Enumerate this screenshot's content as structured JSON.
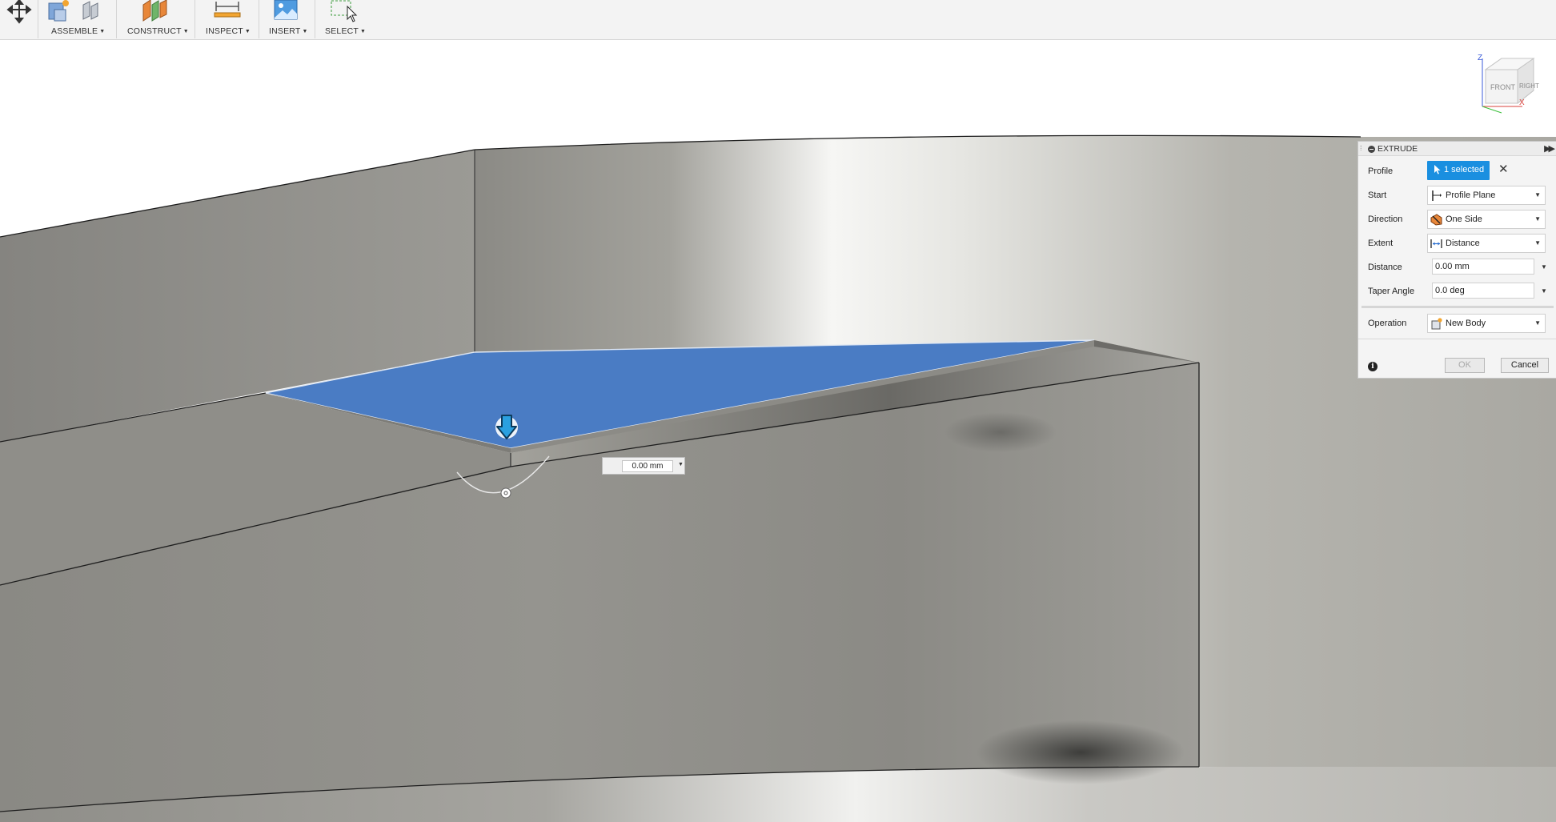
{
  "toolbar": {
    "groups": [
      {
        "label": "ASSEMBLE",
        "icon": "assemble-icon"
      },
      {
        "label": "CONSTRUCT",
        "icon": "construct-plane-icon"
      },
      {
        "label": "INSPECT",
        "icon": "measure-icon"
      },
      {
        "label": "INSERT",
        "icon": "insert-image-icon"
      },
      {
        "label": "SELECT",
        "icon": "select-window-icon"
      }
    ]
  },
  "viewcube": {
    "front": "FRONT",
    "right": "RIGHT",
    "axis_z": "Z",
    "axis_x": "X"
  },
  "extrude_panel": {
    "title": "EXTRUDE",
    "profile_label": "Profile",
    "profile_value": "1 selected",
    "start_label": "Start",
    "start_value": "Profile Plane",
    "direction_label": "Direction",
    "direction_value": "One Side",
    "extent_label": "Extent",
    "extent_value": "Distance",
    "distance_label": "Distance",
    "distance_value": "0.00 mm",
    "taper_label": "Taper Angle",
    "taper_value": "0.0 deg",
    "operation_label": "Operation",
    "operation_value": "New Body",
    "ok_label": "OK",
    "cancel_label": "Cancel",
    "ok_enabled": false
  },
  "manipulator": {
    "distance_value": "0.00 mm"
  },
  "colors": {
    "selected_face": "#4a7cc4",
    "selection_button": "#1a8fe0",
    "body_gray": "#8d8c86"
  }
}
